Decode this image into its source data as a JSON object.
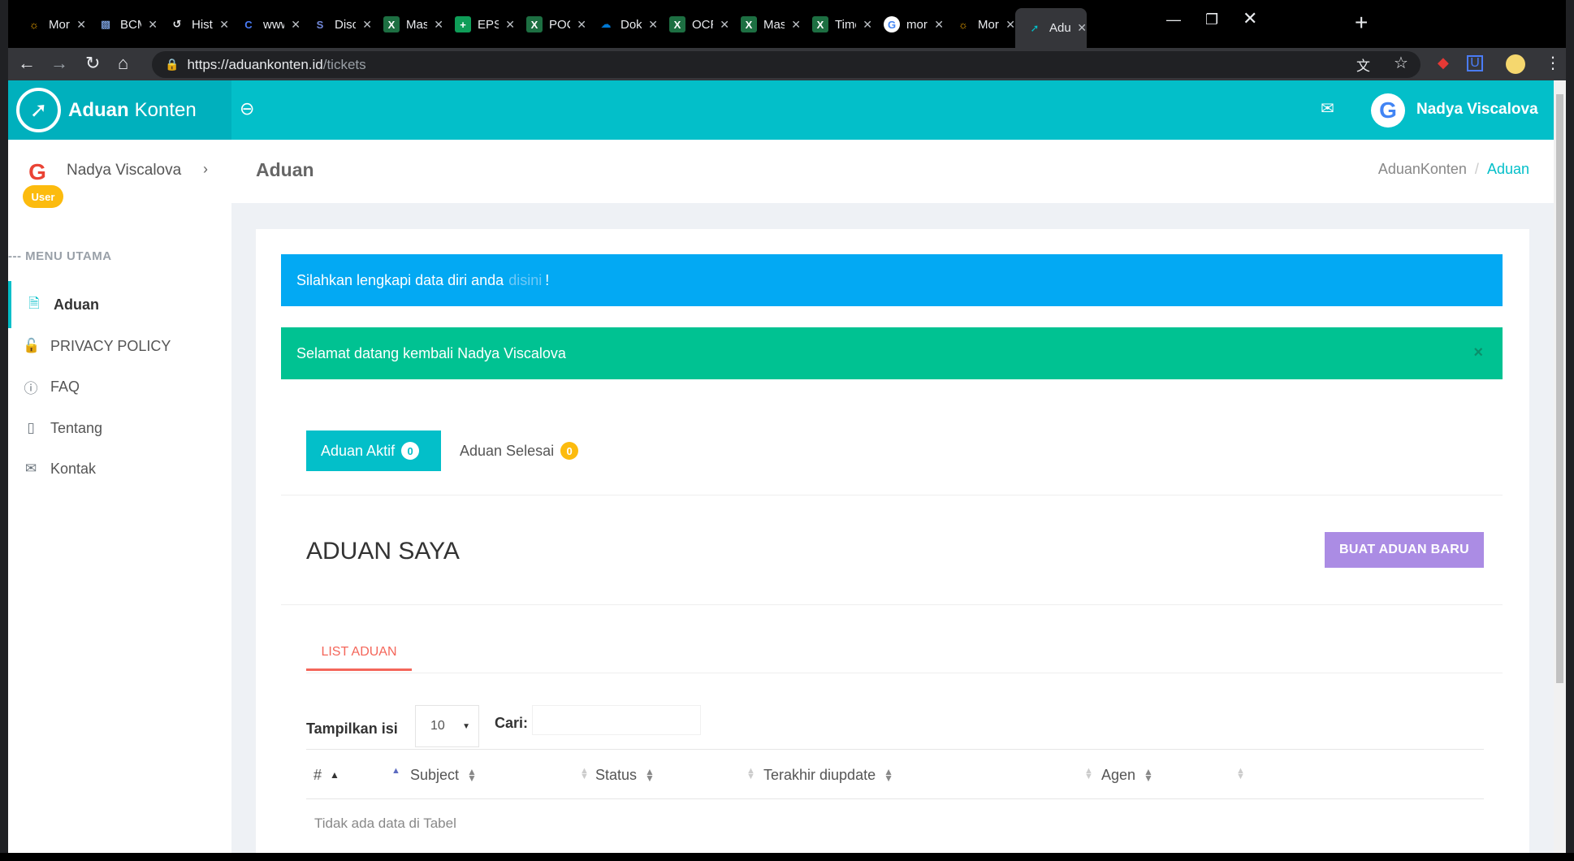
{
  "browser": {
    "tabs": [
      {
        "title": "Mor",
        "icon": "bulb-icon",
        "color": "#f9ab00"
      },
      {
        "title": "BCM",
        "icon": "robot-icon",
        "color": "#8ab4f8"
      },
      {
        "title": "Hist",
        "icon": "history-icon",
        "color": "#e8eaed"
      },
      {
        "title": "www",
        "icon": "c-logo-icon",
        "color": "#4a7cf7"
      },
      {
        "title": "Disc",
        "icon": "discord-icon",
        "color": "#7289da"
      },
      {
        "title": "Mas",
        "icon": "excel-icon",
        "color": "#1d6f42"
      },
      {
        "title": "EPS",
        "icon": "sheets-icon",
        "color": "#0f9d58"
      },
      {
        "title": "POC",
        "icon": "excel-icon",
        "color": "#1d6f42"
      },
      {
        "title": "Dok",
        "icon": "onedrive-icon",
        "color": "#0078d4"
      },
      {
        "title": "OCR",
        "icon": "excel-icon",
        "color": "#1d6f42"
      },
      {
        "title": "Mas",
        "icon": "excel-icon",
        "color": "#1d6f42"
      },
      {
        "title": "Time",
        "icon": "excel-icon",
        "color": "#1d6f42"
      },
      {
        "title": "mor",
        "icon": "google-icon",
        "color": "#ffffff"
      },
      {
        "title": "Mor",
        "icon": "bulb-icon",
        "color": "#f9ab00"
      },
      {
        "title": "Adu",
        "icon": "aduan-icon",
        "color": "#03bfc9",
        "active": true
      }
    ],
    "url_host": "https://aduankonten.id",
    "url_path": "/tickets"
  },
  "app": {
    "brand_bold": "Aduan",
    "brand_light": "Konten",
    "user_name": "Nadya Viscalova",
    "user_role": "User",
    "accent": "#03bfc9"
  },
  "sidebar": {
    "menu_header": "--- MENU UTAMA",
    "items": [
      {
        "label": "Aduan",
        "icon": "file-icon",
        "active": true
      },
      {
        "label": "PRIVACY POLICY",
        "icon": "lock-icon"
      },
      {
        "label": "FAQ",
        "icon": "help-circle-icon"
      },
      {
        "label": "Tentang",
        "icon": "book-icon"
      },
      {
        "label": "Kontak",
        "icon": "mail-open-icon"
      }
    ]
  },
  "header": {
    "page_title": "Aduan",
    "breadcrumb": [
      "AduanKonten",
      "Aduan"
    ]
  },
  "alerts": {
    "info_text": "Silahkan lengkapi data diri anda",
    "info_link": "disini",
    "info_suffix": "!",
    "success_text": "Selamat datang kembali Nadya Viscalova",
    "success_close": "×"
  },
  "tabs": {
    "active_label": "Aduan Aktif",
    "active_count": "0",
    "done_label": "Aduan Selesai",
    "done_count": "0"
  },
  "section": {
    "title": "ADUAN SAYA",
    "new_button": "BUAT ADUAN BARU",
    "list_tab": "LIST ADUAN"
  },
  "table": {
    "length_label": "Tampilkan isi",
    "length_value": "10",
    "search_label": "Cari:",
    "search_value": "",
    "columns": [
      "#",
      "Subject",
      "Status",
      "Terakhir diupdate",
      "Agen"
    ],
    "empty_text": "Tidak ada data di Tabel"
  }
}
